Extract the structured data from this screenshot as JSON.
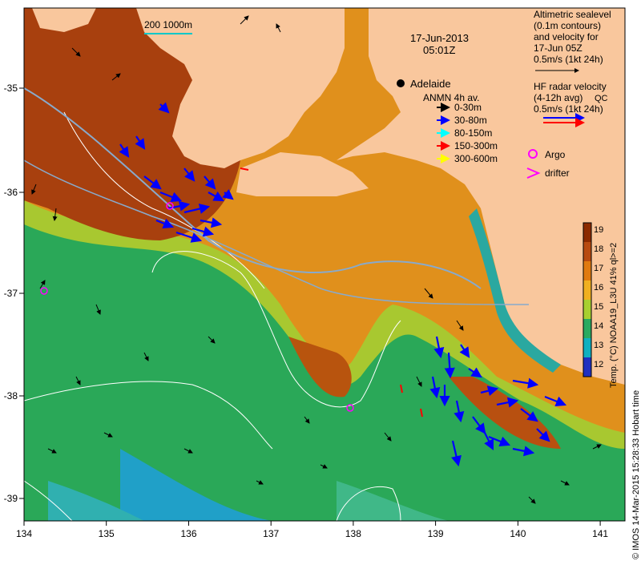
{
  "header": {
    "date": "17-Jun-2013",
    "time": "05:01Z",
    "scale_text": "200  1000m"
  },
  "city": {
    "name": "Adelaide",
    "lon": 138.6,
    "lat": -34.93
  },
  "legend_altimetry": {
    "lines": [
      "Altimetric sealevel",
      "(0.1m contours)",
      "and velocity for",
      "17-Jun 05Z",
      "0.5m/s (1kt 24h)"
    ]
  },
  "legend_hf": {
    "lines": [
      "HF radar velocity",
      "(4-12h avg)",
      "0.5m/s (1kt 24h)"
    ],
    "note": "QC"
  },
  "legend_anmn": {
    "title": "ANMN 4h av.",
    "items": [
      {
        "label": "0-30m",
        "color": "#000000"
      },
      {
        "label": "30-80m",
        "color": "#0000ff"
      },
      {
        "label": "80-150m",
        "color": "#00ffff"
      },
      {
        "label": "150-300m",
        "color": "#ff0000"
      },
      {
        "label": "300-600m",
        "color": "#ffff00"
      }
    ]
  },
  "legend_markers": {
    "argo": "Argo",
    "drifter": "drifter"
  },
  "colorbar": {
    "title": "Temp. (°C) NOAA19_L3U 41% ql>=2",
    "ticks": [
      "19",
      "18",
      "17",
      "16",
      "15",
      "14",
      "13",
      "12"
    ],
    "colors": [
      "#8b2a00",
      "#b84a10",
      "#e07a10",
      "#f0b020",
      "#a8d030",
      "#2aaa60",
      "#10b0c0",
      "#2030c0"
    ]
  },
  "credit": "© IMOS 14-Mar-2015 15:28:33 Hobart time",
  "axes": {
    "x_ticks": [
      "134",
      "135",
      "136",
      "137",
      "138",
      "139",
      "140",
      "141"
    ],
    "y_ticks": [
      "-35",
      "-36",
      "-37",
      "-38",
      "-39"
    ],
    "x_range": [
      134,
      141.3
    ],
    "y_range": [
      -39.55,
      -34.25
    ]
  },
  "colors": {
    "land": "#f9c79d",
    "hot": "#9a3a0a",
    "warm": "#e08a18",
    "mid": "#b8c830",
    "cool": "#2aa858",
    "cold": "#1890c8"
  }
}
